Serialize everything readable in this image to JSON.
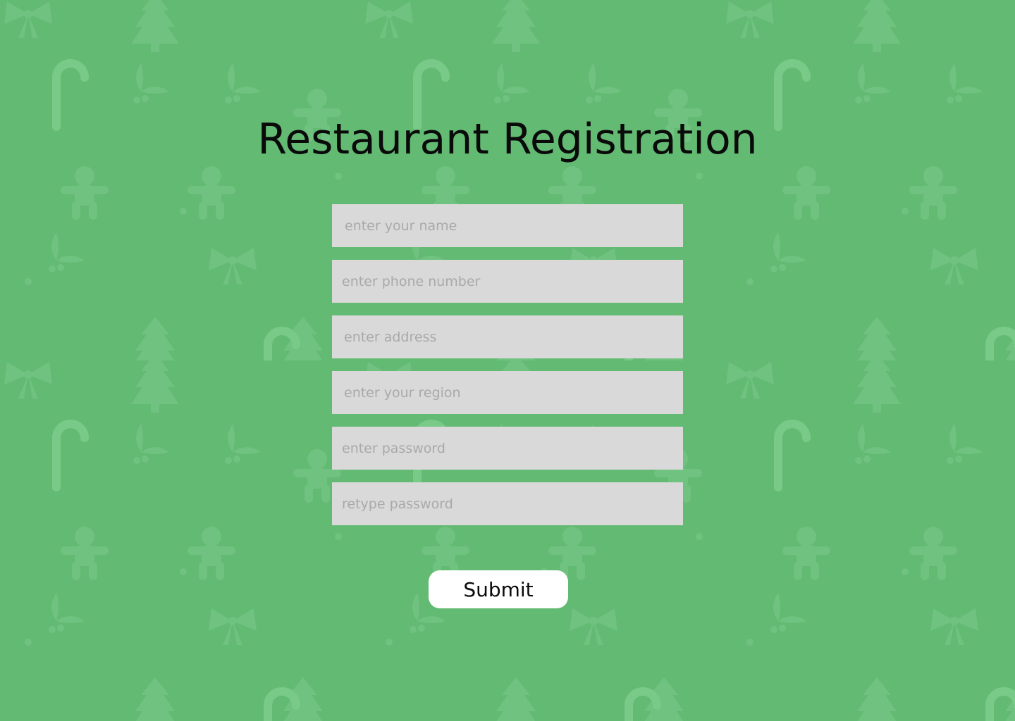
{
  "page": {
    "title": "Restaurant Registration",
    "background_color": "#63ba73",
    "background_pattern_icons": [
      "candy-cane-icon",
      "gingerbread-man-icon",
      "christmas-tree-icon",
      "bow-icon",
      "holly-icon"
    ]
  },
  "form": {
    "fields": [
      {
        "name": "name-input",
        "placeholder": "enter your name",
        "value": ""
      },
      {
        "name": "phone-input",
        "placeholder": "enter phone number",
        "value": ""
      },
      {
        "name": "address-input",
        "placeholder": "enter address",
        "value": ""
      },
      {
        "name": "region-input",
        "placeholder": "enter your region",
        "value": ""
      },
      {
        "name": "password-input",
        "placeholder": "enter password",
        "value": ""
      },
      {
        "name": "retype-password-input",
        "placeholder": "retype password",
        "value": ""
      }
    ],
    "submit_label": "Submit",
    "field_color": "#d9d9d9",
    "button_color": "#ffffff"
  }
}
